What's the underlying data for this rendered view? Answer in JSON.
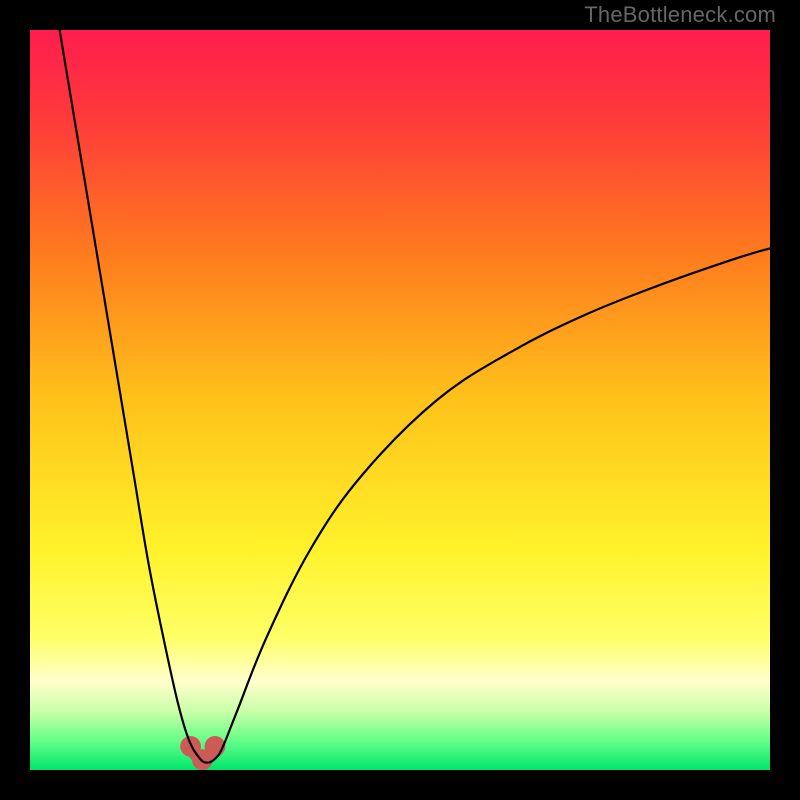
{
  "watermark": "TheBottleneck.com",
  "chart_data": {
    "type": "line",
    "title": "",
    "xlabel": "",
    "ylabel": "",
    "xlim": [
      0,
      100
    ],
    "ylim": [
      0,
      100
    ],
    "background_gradient": {
      "stops": [
        {
          "pos": 0.0,
          "color": "#ff1d4e"
        },
        {
          "pos": 0.12,
          "color": "#ff3a3a"
        },
        {
          "pos": 0.3,
          "color": "#ff7a1f"
        },
        {
          "pos": 0.5,
          "color": "#ffc21a"
        },
        {
          "pos": 0.7,
          "color": "#fff22a"
        },
        {
          "pos": 0.82,
          "color": "#ffff66"
        },
        {
          "pos": 0.88,
          "color": "#ffffcc"
        },
        {
          "pos": 0.92,
          "color": "#ccffaa"
        },
        {
          "pos": 0.96,
          "color": "#66ff88"
        },
        {
          "pos": 1.0,
          "color": "#00e56b"
        }
      ]
    },
    "series": [
      {
        "name": "bottleneck-curve",
        "color": "#000000",
        "width": 2.2,
        "x": [
          4,
          6,
          8,
          10,
          12,
          14,
          16,
          18,
          20,
          21.5,
          23,
          24,
          25,
          26,
          28,
          32,
          38,
          45,
          55,
          65,
          75,
          85,
          95,
          100
        ],
        "values": [
          100,
          88,
          76,
          64,
          52,
          40,
          28,
          18,
          9,
          4,
          1.5,
          1,
          1.5,
          3,
          8,
          18,
          30,
          40,
          50,
          56.5,
          61.5,
          65.5,
          69,
          70.5
        ]
      }
    ],
    "markers": [
      {
        "name": "min-marker-left",
        "x": 21.7,
        "y": 3.2,
        "r": 1.4,
        "color": "#cc5b56"
      },
      {
        "name": "min-marker-bottom",
        "x": 23.3,
        "y": 1.4,
        "r": 1.4,
        "color": "#cc5b56"
      },
      {
        "name": "min-marker-right",
        "x": 25.0,
        "y": 3.2,
        "r": 1.4,
        "color": "#cc5b56"
      }
    ],
    "min_connector": {
      "color": "#cc5b56",
      "width": 8,
      "points_x": [
        21.7,
        22.0,
        22.8,
        23.3,
        23.9,
        24.6,
        25.0
      ],
      "points_y": [
        3.2,
        2.0,
        1.3,
        1.2,
        1.3,
        2.0,
        3.2
      ]
    }
  }
}
